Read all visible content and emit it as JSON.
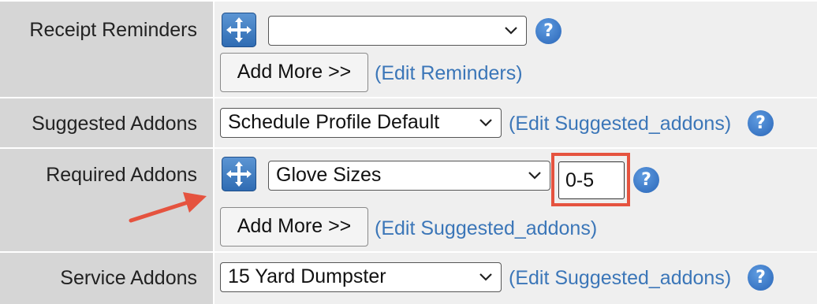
{
  "rows": {
    "receipt": {
      "label": "Receipt Reminders",
      "select_value": "",
      "add_more": "Add More >>",
      "edit_link": "(Edit Reminders)"
    },
    "suggested": {
      "label": "Suggested Addons",
      "select_value": "Schedule Profile Default",
      "edit_link": "(Edit Suggested_addons)"
    },
    "required": {
      "label": "Required Addons",
      "select_value": "Glove Sizes",
      "quantity": "0-5",
      "add_more": "Add More >>",
      "edit_link": "(Edit Suggested_addons)"
    },
    "service": {
      "label": "Service Addons",
      "select_value": "15 Yard Dumpster",
      "edit_link": "(Edit Suggested_addons)"
    }
  },
  "help_glyph": "?",
  "colors": {
    "link": "#3b76b8",
    "highlight": "#e5533f",
    "arrow": "#e5533f",
    "help_icon": "#2a66b8"
  },
  "icons": [
    "drag-move-icon",
    "help-icon",
    "chevron-down-icon",
    "annotation-arrow"
  ]
}
